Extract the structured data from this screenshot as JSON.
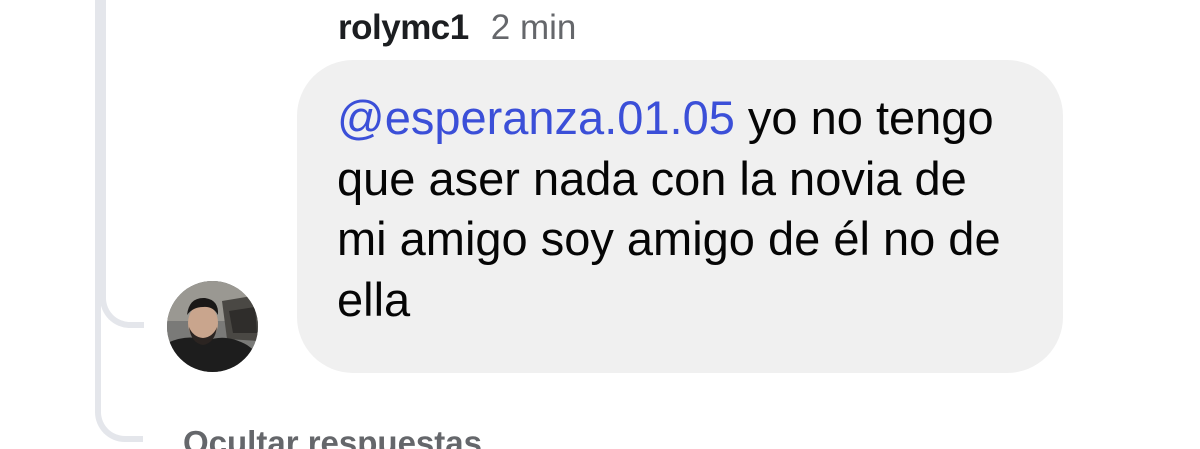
{
  "comment": {
    "author": "rolymc1",
    "time": "2 min",
    "mention": "@esperanza.01.05",
    "text": " yo no tengo que aser nada con la novia de mi amigo soy amigo de él no de ella"
  },
  "footer": {
    "hide_replies_label": "Ocultar respuestas"
  },
  "colors": {
    "bubble_bg": "#f0f0f0",
    "mention": "#3b4fd8",
    "secondary_text": "#65676b",
    "thread_line": "#e4e6eb"
  }
}
